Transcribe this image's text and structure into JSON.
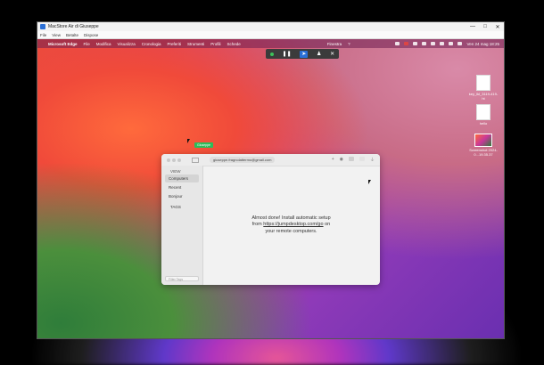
{
  "window": {
    "title": "MacStore Air di Giuseppe",
    "menu": [
      "File",
      "View",
      "Betalte",
      "Dispose"
    ],
    "controls": [
      "—",
      "□",
      "✕"
    ]
  },
  "mac_menubar": {
    "app_name": "Microsoft Edge",
    "items": [
      "File",
      "Modifica",
      "Visualizza",
      "Cronologia",
      "Preferiti",
      "Strumenti",
      "Profili",
      "Schede"
    ],
    "center_item": "Finestra",
    "help": "?",
    "clock": "Ven 24 mag 18:25"
  },
  "control_toolbar": {
    "status": "connected",
    "buttons": [
      "pause",
      "pointer",
      "user",
      "close"
    ]
  },
  "desktop_items": [
    {
      "label": "key_lkl_3119-419-ht"
    },
    {
      "label": "hello"
    },
    {
      "label": "Screenshot 2024-0...19.35.37"
    }
  ],
  "cursor_tag": "Giuseppe",
  "app_window": {
    "email": "giuseppe.fragnolattermo@gmail.com",
    "sidebar_header": "VIEW",
    "sidebar_items": [
      "Computers",
      "Recent",
      "Bonjour"
    ],
    "sidebar_active": "Computers",
    "tags_label": "TAGS",
    "search_placeholder": "Filter Tags",
    "message_line1": "Almost done! Install automatic setup",
    "message_from": "from ",
    "message_link": "https://jumpdesktop.com/go",
    "message_on": " on",
    "message_line3": "your remote computers."
  },
  "dock": {
    "icons": [
      {
        "name": "finder",
        "color": "#3d8be8"
      },
      {
        "name": "launchpad",
        "color": "#e7eef9"
      },
      {
        "name": "safari",
        "color": "#2f8fe8"
      },
      {
        "name": "edge",
        "color": "#1fa3a8"
      },
      {
        "name": "mail",
        "color": "#3f7de8"
      },
      {
        "name": "chrome",
        "color": "#f0c540"
      },
      {
        "name": "photos",
        "color": "#f3a0c0"
      },
      {
        "name": "facetime",
        "color": "#35c155"
      },
      {
        "name": "calendar",
        "color": "#fafafa"
      },
      {
        "name": "contacts",
        "color": "#c8a27a"
      },
      {
        "name": "reminders",
        "color": "#f5f5f5"
      },
      {
        "name": "notes",
        "color": "#f7d95b"
      },
      {
        "name": "freeform",
        "color": "#f5f5f5"
      },
      {
        "name": "appletv",
        "color": "#1a1a1a"
      },
      {
        "name": "music",
        "color": "#f2374f"
      },
      {
        "name": "podcasts",
        "color": "#9b4de0"
      },
      {
        "name": "numbers",
        "color": "#37b04a"
      },
      {
        "name": "pages",
        "color": "#f2a23a"
      },
      {
        "name": "keynote",
        "color": "#3a7ce8"
      },
      {
        "name": "appstore",
        "color": "#2f8fe8"
      },
      {
        "name": "settings",
        "color": "#8a8a8a"
      },
      {
        "name": "xcode",
        "color": "#3aa0e8"
      },
      {
        "name": "tv",
        "color": "#222"
      },
      {
        "name": "whatsapp",
        "color": "#2bc25a"
      },
      {
        "name": "telegram",
        "color": "#2ea6e0"
      },
      {
        "name": "textedit",
        "color": "#f2f2f2"
      },
      {
        "name": "preview",
        "color": "#6aa2e0"
      },
      {
        "name": "app-1",
        "color": "#e85a3c"
      },
      {
        "name": "app-2",
        "color": "#eeeeee"
      },
      {
        "name": "app-3",
        "color": "#3a7ce8"
      },
      {
        "name": "chrome-2",
        "color": "#f0c540"
      },
      {
        "name": "app-4",
        "color": "#e8453c"
      },
      {
        "name": "app-5",
        "color": "#4ab0f0"
      },
      {
        "name": "app-6",
        "color": "#cccccc"
      },
      {
        "name": "app-7",
        "color": "#2f8fe8"
      },
      {
        "name": "app-8",
        "color": "#3a3a3a"
      },
      {
        "name": "app-9",
        "color": "#f2f2f2"
      },
      {
        "name": "screenshot",
        "color": "#f2f2f2"
      },
      {
        "name": "downloads",
        "color": "#4a9cf0"
      },
      {
        "name": "app-10",
        "color": "#c0c0c0"
      },
      {
        "name": "trash",
        "color": "#d8d8d8"
      }
    ]
  }
}
